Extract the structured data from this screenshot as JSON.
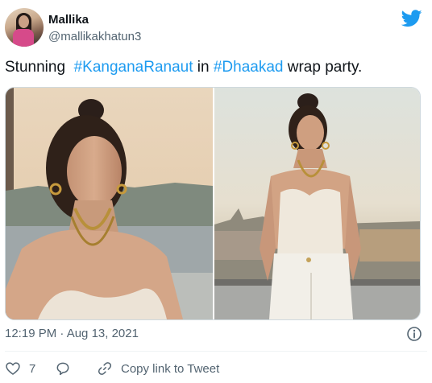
{
  "user": {
    "display_name": "Mallika",
    "handle": "@mallikakhatun3"
  },
  "tweet": {
    "text_prefix": "Stunning  ",
    "hashtag1": "#KanganaRanaut",
    "text_mid": " in ",
    "hashtag2": "#Dhaakad",
    "text_suffix": " wrap party."
  },
  "meta": {
    "timestamp": "12:19 PM · Aug 13, 2021"
  },
  "actions": {
    "like_count": "7",
    "copy_link_label": "Copy link to Tweet"
  },
  "icons": {
    "brand": "twitter-bird-icon",
    "like": "heart-icon",
    "reply": "reply-bubble-icon",
    "copy": "link-icon",
    "info": "info-icon"
  },
  "colors": {
    "accent": "#1d9bf0",
    "text": "#0f1419",
    "muted": "#536471"
  }
}
